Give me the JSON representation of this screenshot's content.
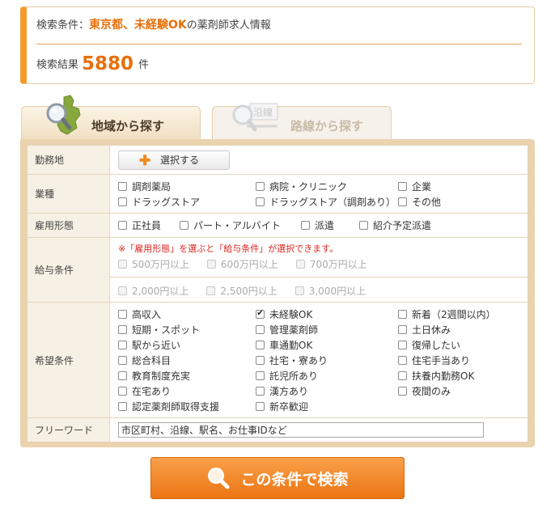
{
  "summary": {
    "condition_prefix": "検索条件：",
    "condition_highlight": "東京都、未経験OK",
    "condition_suffix": "の薬剤師求人情報",
    "result_label": "検索結果",
    "result_count": "5880",
    "result_unit": "件"
  },
  "tabs": {
    "area": "地域から探す",
    "route": "路線から探す",
    "route_icon_text": "沿線"
  },
  "form": {
    "kinmu": {
      "label": "勤務地",
      "button": "選択する"
    },
    "gyoshu": {
      "label": "業種",
      "options": [
        {
          "text": "調剤薬局",
          "checked": false
        },
        {
          "text": "病院・クリニック",
          "checked": false
        },
        {
          "text": "企業",
          "checked": false
        },
        {
          "text": "ドラッグストア",
          "checked": false
        },
        {
          "text": "ドラッグストア（調剤あり）",
          "checked": false
        },
        {
          "text": "その他",
          "checked": false
        }
      ]
    },
    "koyo": {
      "label": "雇用形態",
      "options": [
        {
          "text": "正社員",
          "checked": false
        },
        {
          "text": "パート・アルバイト",
          "checked": false
        },
        {
          "text": "派遣",
          "checked": false
        },
        {
          "text": "紹介予定派遣",
          "checked": false
        }
      ]
    },
    "kyuyo": {
      "label": "給与条件",
      "note": "※「雇用形態」を選ぶと「給与条件」が選択できます。",
      "annual": [
        "500万円以上",
        "600万円以上",
        "700万円以上"
      ],
      "hourly": [
        "2,000円以上",
        "2,500円以上",
        "3,000円以上"
      ]
    },
    "kibo": {
      "label": "希望条件",
      "options": [
        {
          "text": "高収入",
          "checked": false
        },
        {
          "text": "未経験OK",
          "checked": true
        },
        {
          "text": "新着（2週間以内）",
          "checked": false
        },
        {
          "text": "短期・スポット",
          "checked": false
        },
        {
          "text": "管理薬剤師",
          "checked": false
        },
        {
          "text": "土日休み",
          "checked": false
        },
        {
          "text": "駅から近い",
          "checked": false
        },
        {
          "text": "車通勤OK",
          "checked": false
        },
        {
          "text": "復帰したい",
          "checked": false
        },
        {
          "text": "総合科目",
          "checked": false
        },
        {
          "text": "社宅・寮あり",
          "checked": false
        },
        {
          "text": "住宅手当あり",
          "checked": false
        },
        {
          "text": "教育制度充実",
          "checked": false
        },
        {
          "text": "託児所あり",
          "checked": false
        },
        {
          "text": "扶養内勤務OK",
          "checked": false
        },
        {
          "text": "在宅あり",
          "checked": false
        },
        {
          "text": "漢方あり",
          "checked": false
        },
        {
          "text": "夜間のみ",
          "checked": false
        },
        {
          "text": "認定薬剤師取得支援",
          "checked": false
        },
        {
          "text": "新卒歓迎",
          "checked": false
        }
      ]
    },
    "freeword": {
      "label": "フリーワード",
      "placeholder": "市区町村、沿線、駅名、お仕事IDなど",
      "value": ""
    }
  },
  "search_button": "この条件で検索",
  "colors": {
    "accent": "#ec7512",
    "highlight_text": "#e8700b",
    "panel_bg": "#ead3ad",
    "note_red": "#d9251d"
  },
  "icons": {
    "area_tab": "magnifier-map-icon",
    "route_tab": "magnifier-route-icon",
    "select": "plus-icon",
    "search": "magnifier-icon"
  }
}
